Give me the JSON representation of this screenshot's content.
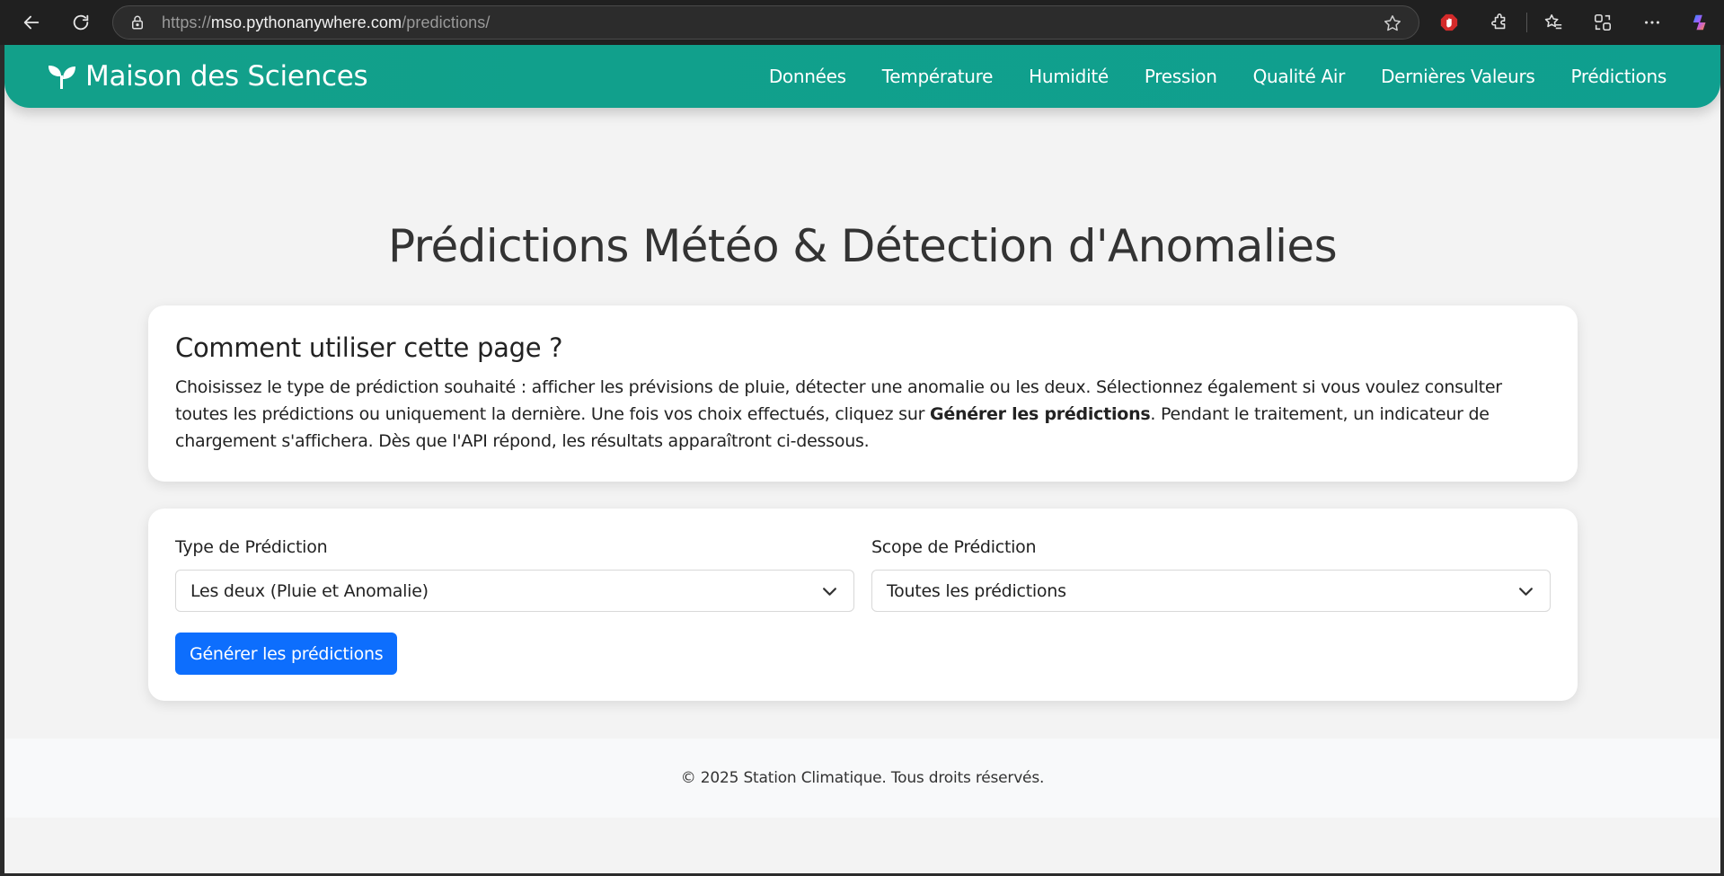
{
  "browser": {
    "url_scheme": "https://",
    "url_host": "mso.pythonanywhere.com",
    "url_path": "/predictions/"
  },
  "header": {
    "brand": "Maison des Sciences",
    "brand_icon": "seedling-icon",
    "nav": [
      {
        "label": "Données"
      },
      {
        "label": "Température"
      },
      {
        "label": "Humidité"
      },
      {
        "label": "Pression"
      },
      {
        "label": "Qualité Air"
      },
      {
        "label": "Dernières Valeurs"
      },
      {
        "label": "Prédictions"
      }
    ]
  },
  "main": {
    "title": "Prédictions Météo & Détection d'Anomalies",
    "help": {
      "heading": "Comment utiliser cette page ?",
      "text_before": "Choisissez le type de prédiction souhaité : afficher les prévisions de pluie, détecter une anomalie ou les deux. Sélectionnez également si vous voulez consulter toutes les prédictions ou uniquement la dernière. Une fois vos choix effectués, cliquez sur ",
      "text_bold": "Générer les prédictions",
      "text_after": ". Pendant le traitement, un indicateur de chargement s'affichera. Dès que l'API répond, les résultats apparaîtront ci-dessous."
    },
    "form": {
      "type_label": "Type de Prédiction",
      "type_value": "Les deux (Pluie et Anomalie)",
      "scope_label": "Scope de Prédiction",
      "scope_value": "Toutes les prédictions",
      "submit_label": "Générer les prédictions"
    }
  },
  "footer": {
    "text": "© 2025 Station Climatique. Tous droits réservés."
  },
  "colors": {
    "header_bg": "#12a08a",
    "button_bg": "#0d6efd",
    "page_bg": "#f3f3f3"
  }
}
